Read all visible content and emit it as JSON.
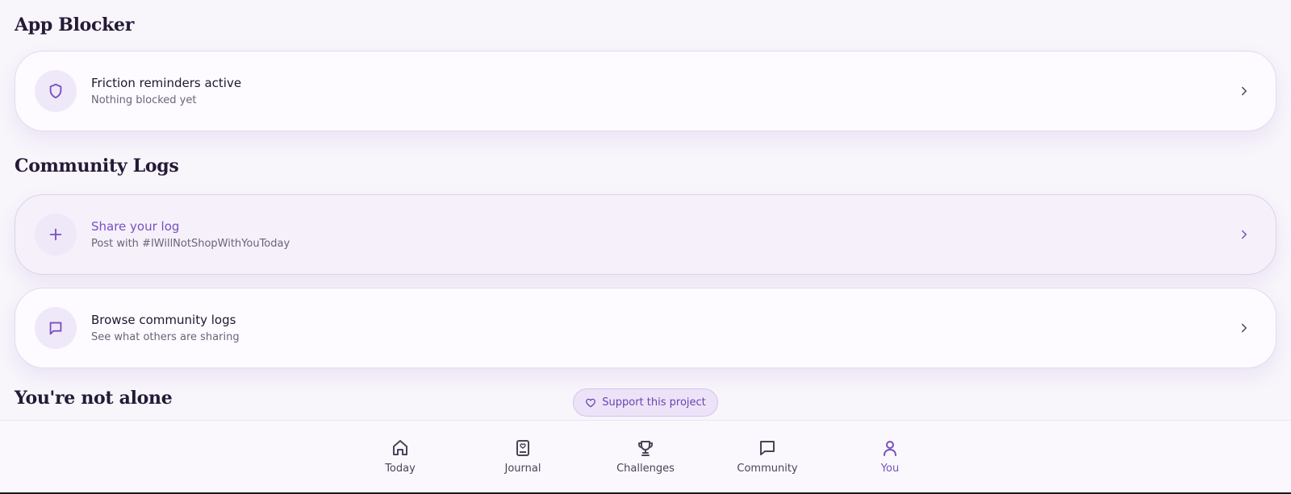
{
  "sections": {
    "app_blocker": "App Blocker",
    "community_logs": "Community Logs",
    "not_alone": "You're not alone"
  },
  "cards": [
    {
      "title": "Friction reminders active",
      "subtitle": "Nothing blocked yet",
      "icon": "shield-icon"
    },
    {
      "title": "Share your log",
      "subtitle": "Post with #IWillNotShopWithYouToday",
      "icon": "plus-icon"
    },
    {
      "title": "Browse community logs",
      "subtitle": "See what others are sharing",
      "icon": "message-square-icon"
    }
  ],
  "support": {
    "label": "Support this project",
    "icon": "heart-icon"
  },
  "nav": {
    "today": "Today",
    "journal": "Journal",
    "challenges": "Challenges",
    "community": "Community",
    "you": "You",
    "active": "You"
  },
  "colors": {
    "accent": "#7a4fbf",
    "background": "#f8f5fb",
    "icon_bg": "#efe8f8"
  }
}
